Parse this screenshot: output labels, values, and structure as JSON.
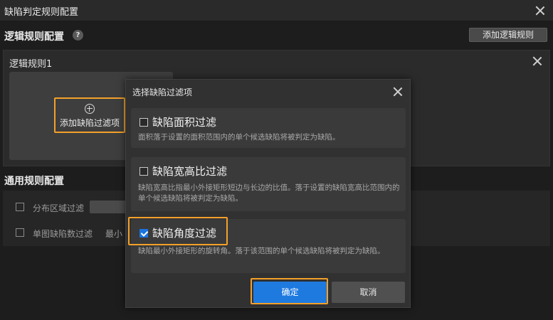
{
  "window": {
    "title": "缺陷判定规则配置"
  },
  "logic": {
    "section_title": "逻辑规则配置",
    "help_icon": "?",
    "add_rule_label": "添加逻辑规则",
    "rule_name": "逻辑规则1",
    "add_filter_label": "添加缺陷过滤项"
  },
  "general": {
    "section_title": "通用规则配置",
    "distribution_label": "分布区域过滤",
    "single_count_label": "单图缺陷数过滤",
    "min_label": "最小"
  },
  "dialog": {
    "title": "选择缺陷过滤项",
    "options": [
      {
        "title": "缺陷面积过滤",
        "checked": false,
        "desc": "面积落于设置的面积范围内的单个候选缺陷将被判定为缺陷。"
      },
      {
        "title": "缺陷宽高比过滤",
        "checked": false,
        "desc": "缺陷宽高比指最小外接矩形短边与长边的比值。落于设置的缺陷宽高比范围内的单个候选缺陷将被判定为缺陷。"
      },
      {
        "title": "缺陷角度过滤",
        "checked": true,
        "desc": "缺陷最小外接矩形的旋转角。落于该范围的单个候选缺陷将被判定为缺陷。"
      }
    ],
    "ok_label": "确定",
    "cancel_label": "取消"
  },
  "colors": {
    "highlight": "#f3a12a",
    "primary": "#1f7ae0"
  }
}
